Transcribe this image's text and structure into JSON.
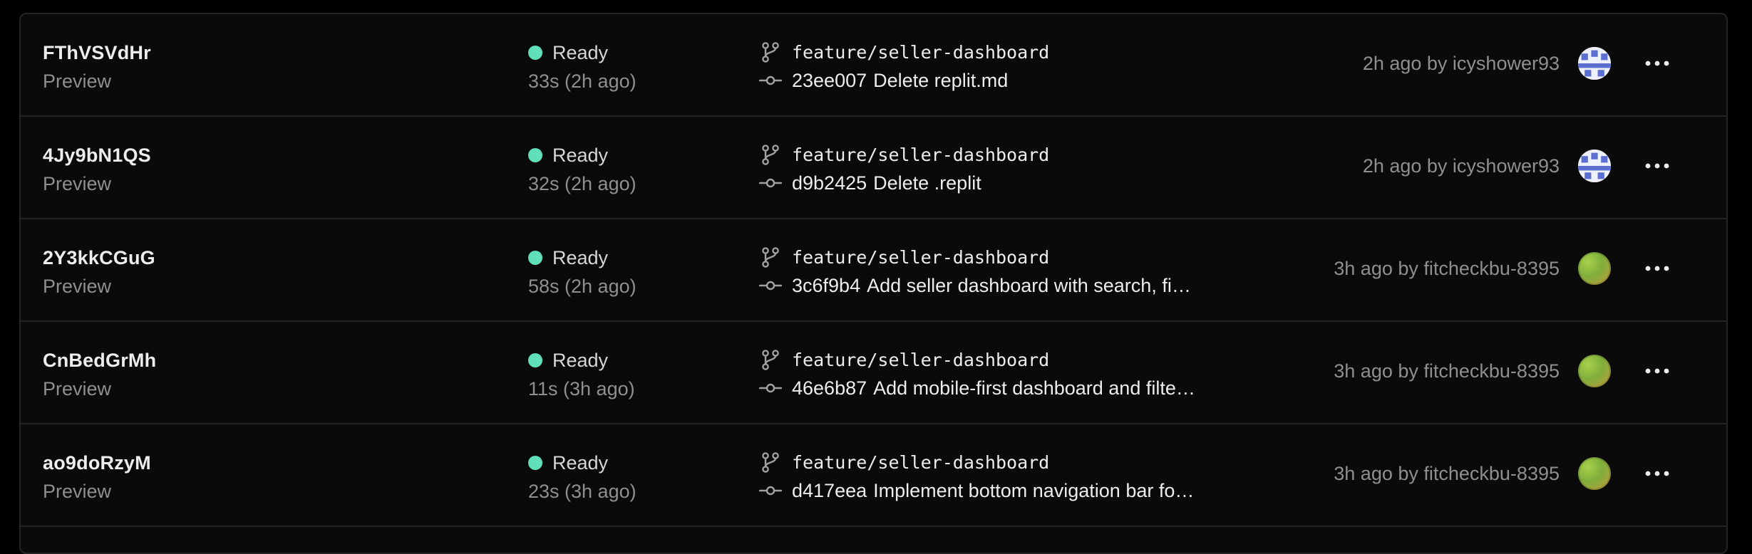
{
  "deployments": [
    {
      "id": "FThVSVdHr",
      "environment": "Preview",
      "status": "Ready",
      "duration": "33s (2h ago)",
      "branch": "feature/seller-dashboard",
      "commit_sha": "23ee007",
      "commit_message": "Delete replit.md",
      "meta": "2h ago by icyshower93",
      "avatar": "pixel"
    },
    {
      "id": "4Jy9bN1QS",
      "environment": "Preview",
      "status": "Ready",
      "duration": "32s (2h ago)",
      "branch": "feature/seller-dashboard",
      "commit_sha": "d9b2425",
      "commit_message": "Delete .replit",
      "meta": "2h ago by icyshower93",
      "avatar": "pixel"
    },
    {
      "id": "2Y3kkCGuG",
      "environment": "Preview",
      "status": "Ready",
      "duration": "58s (2h ago)",
      "branch": "feature/seller-dashboard",
      "commit_sha": "3c6f9b4",
      "commit_message": "Add seller dashboard with search, fi…",
      "meta": "3h ago by fitcheckbu-8395",
      "avatar": "green"
    },
    {
      "id": "CnBedGrMh",
      "environment": "Preview",
      "status": "Ready",
      "duration": "11s (3h ago)",
      "branch": "feature/seller-dashboard",
      "commit_sha": "46e6b87",
      "commit_message": "Add mobile-first dashboard and filte…",
      "meta": "3h ago by fitcheckbu-8395",
      "avatar": "green"
    },
    {
      "id": "ao9doRzyM",
      "environment": "Preview",
      "status": "Ready",
      "duration": "23s (3h ago)",
      "branch": "feature/seller-dashboard",
      "commit_sha": "d417eea",
      "commit_message": "Implement bottom navigation bar fo…",
      "meta": "3h ago by fitcheckbu-8395",
      "avatar": "green"
    }
  ],
  "icons": {
    "branch": "git-branch-icon",
    "commit": "git-commit-icon",
    "more": "ellipsis-horizontal-icon"
  },
  "colors": {
    "status_ready": "#5fe0b6",
    "background": "#0a0a0a",
    "border": "#242424"
  }
}
